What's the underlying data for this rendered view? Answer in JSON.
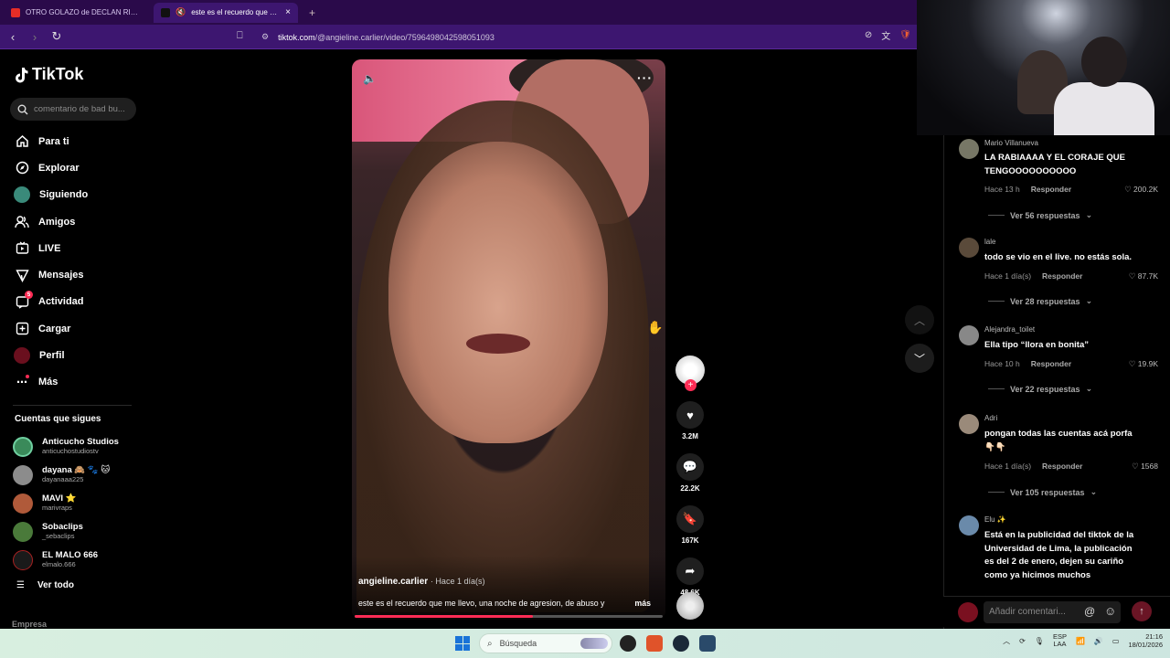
{
  "browser": {
    "tabs": [
      {
        "label": "OTRO GOLAZO de DECLAN RICE y el"
      },
      {
        "label": "este es el recuerdo que me llevo"
      }
    ],
    "new_tab": "+",
    "url_host": "tiktok.com",
    "url_path": "/@angieline.carlier/video/7596498042598051093"
  },
  "sidebar": {
    "logo": "TikTok",
    "search_placeholder": "comentario de bad bu...",
    "nav": [
      {
        "label": "Para ti",
        "icon": "home-icon"
      },
      {
        "label": "Explorar",
        "icon": "compass-icon"
      },
      {
        "label": "Siguiendo",
        "icon": "following-avatar-icon"
      },
      {
        "label": "Amigos",
        "icon": "friends-icon"
      },
      {
        "label": "LIVE",
        "icon": "live-icon"
      },
      {
        "label": "Mensajes",
        "icon": "messages-icon"
      },
      {
        "label": "Actividad",
        "icon": "activity-icon",
        "badge": "5"
      },
      {
        "label": "Cargar",
        "icon": "upload-icon"
      },
      {
        "label": "Perfil",
        "icon": "profile-avatar-icon"
      },
      {
        "label": "Más",
        "icon": "more-icon"
      }
    ],
    "following_title": "Cuentas que sigues",
    "following": [
      {
        "name": "Anticucho Studios",
        "handle": "anticuchostudiostv",
        "color": "#3a8a5a"
      },
      {
        "name": "dayana 🙈 🐾 🐱",
        "handle": "dayanaaa225",
        "color": "#8c8c8c"
      },
      {
        "name": "MAVI ⭐",
        "handle": "marivraps",
        "color": "#b05a3a"
      },
      {
        "name": "Sobaclips",
        "handle": "_sebaclips",
        "color": "#4a7a3a"
      },
      {
        "name": "EL MALO 666",
        "handle": "elmalo.666",
        "color": "#1a1a1a"
      }
    ],
    "see_all": "Ver todo",
    "footer": "Empresa"
  },
  "video": {
    "author": "angieline.carlier",
    "time": "· Hace 1 día(s)",
    "caption": "este es el recuerdo que me llevo, una noche de agresion, de abuso y",
    "more": "más",
    "progress": 0.58
  },
  "actions": {
    "likes": "3.2M",
    "comments": "22.2K",
    "saves": "167K",
    "shares": "48.6K"
  },
  "comments": [
    {
      "user": "Mario Villanueva",
      "text": "LA RABIAAAA Y EL CORAJE QUE TENGOOOOOOOOOO",
      "time": "Hace 13 h",
      "reply": "Responder",
      "likes": "200.2K",
      "more": "Ver 56 respuestas",
      "color": "#776"
    },
    {
      "user": "lale",
      "text": "todo se vio en el live. no estás sola.",
      "time": "Hace 1 día(s)",
      "reply": "Responder",
      "likes": "87.7K",
      "more": "Ver 28 respuestas",
      "color": "#5a4a3a"
    },
    {
      "user": "Alejandra_toilet",
      "text": "Ella tipo “llora en bonita”",
      "time": "Hace 10 h",
      "reply": "Responder",
      "likes": "19.9K",
      "more": "Ver 22 respuestas",
      "color": "#888"
    },
    {
      "user": "Adri",
      "text": "pongan todas las cuentas acá porfa 👇🏻👇🏻",
      "time": "Hace 1 día(s)",
      "reply": "Responder",
      "likes": "1568",
      "more": "Ver 105 respuestas",
      "color": "#9a8a7a"
    },
    {
      "user": "Elu ✨",
      "text": "Está en la publicidad del tiktok de la Universidad de Lima, la publicación es del 2 de enero, dejen su cariño como ya hicimos muchos",
      "time": "",
      "reply": "",
      "likes": "",
      "more": "",
      "color": "#6a8aaa"
    }
  ],
  "comment_input": {
    "placeholder": "Añadir comentari..."
  },
  "taskbar": {
    "search": "Búsqueda",
    "lang_1": "ESP",
    "lang_2": "LAA",
    "time": "21:16",
    "date": "18/01/2026"
  }
}
